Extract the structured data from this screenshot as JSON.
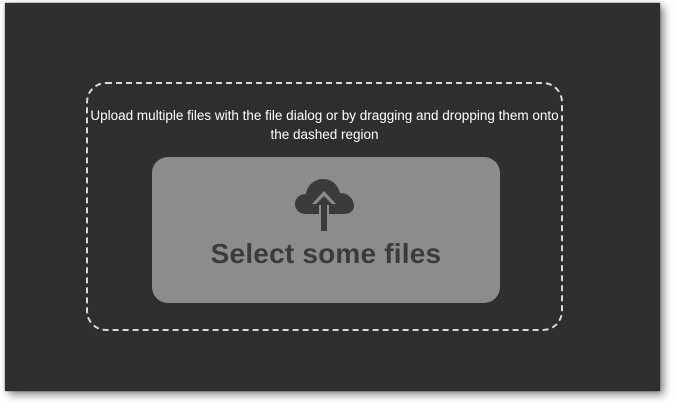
{
  "upload": {
    "instructions": "Upload multiple files with the file dialog or by dragging and dropping them onto the dashed region",
    "button_label": "Select some files",
    "icon": "cloud-upload-icon"
  },
  "colors": {
    "background": "#2f2f2f",
    "button_background": "#8c8c8c",
    "button_text": "#3b3b3b",
    "dashed_border": "#d9d9d9",
    "instruction_text": "#ffffff"
  }
}
